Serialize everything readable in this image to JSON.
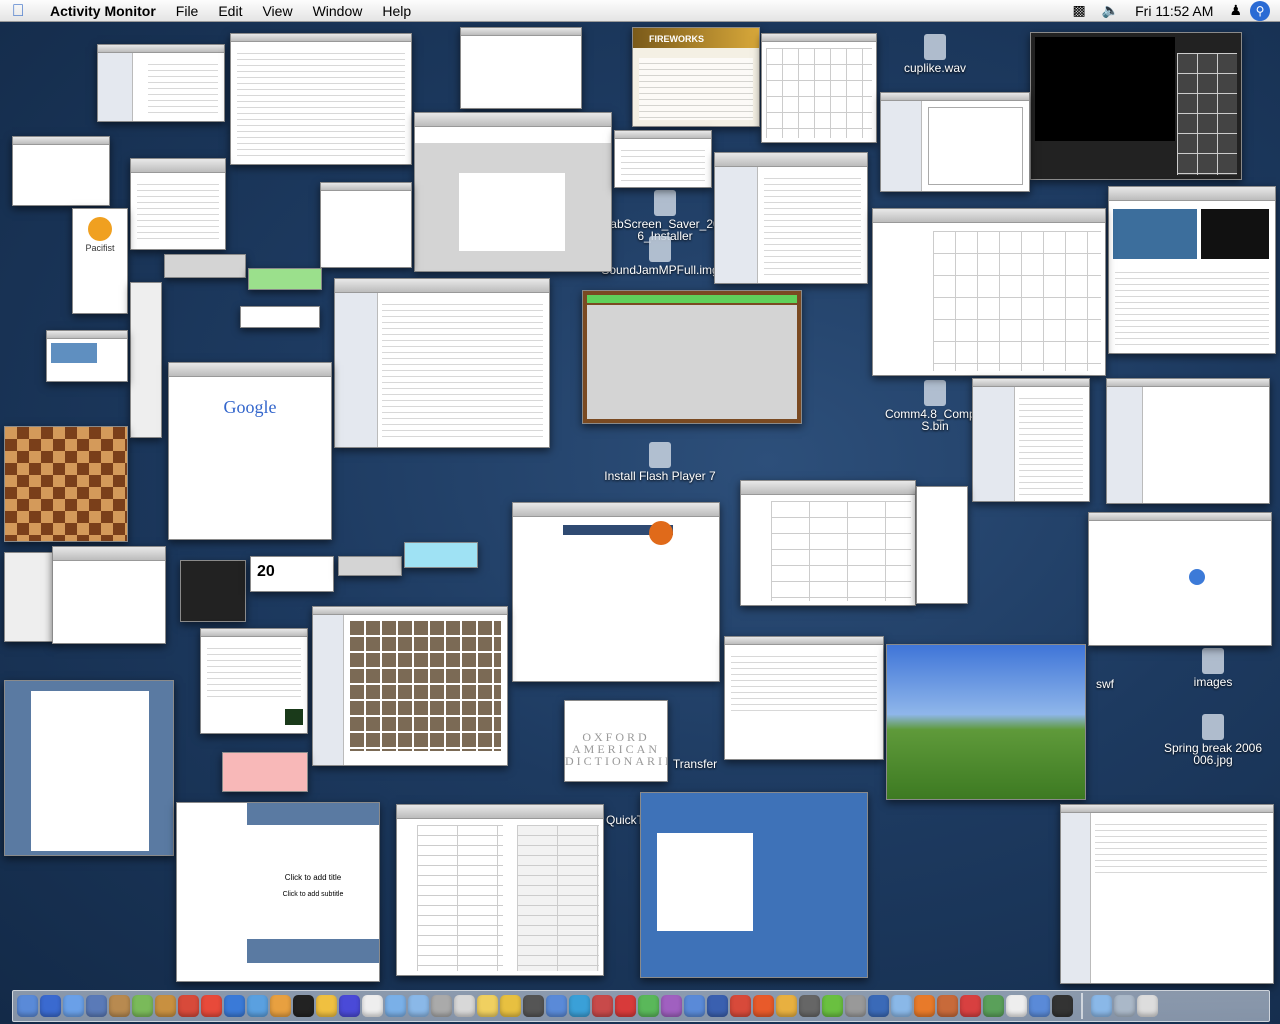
{
  "menubar": {
    "app_name": "Activity Monitor",
    "menus": [
      "File",
      "Edit",
      "View",
      "Window",
      "Help"
    ],
    "clock": "Fri 11:52 AM"
  },
  "desktop_icons": [
    {
      "label": "cuplike.wav"
    },
    {
      "label": "abScreen_Saver_20 6_Installer"
    },
    {
      "label": "SoundJamMPFull.img"
    },
    {
      "label": "Comm4.8_Comple S.bin"
    },
    {
      "label": "Install Flash Player 7"
    },
    {
      "label": "images"
    },
    {
      "label": "Spring break 2006 006.jpg"
    },
    {
      "label": "swf"
    },
    {
      "label": "Transfer"
    },
    {
      "label": "QuickT"
    }
  ],
  "windows": {
    "fireworks_label": "FIREWORKS",
    "google_logo": "Google",
    "pacifist_label": "Pacifist",
    "calendar_day": "20",
    "oxford_text": "OXFORD AMERICAN DICTIONARIES",
    "slide_title": "Click to add title",
    "slide_subtitle": "Click to add subtitle"
  }
}
